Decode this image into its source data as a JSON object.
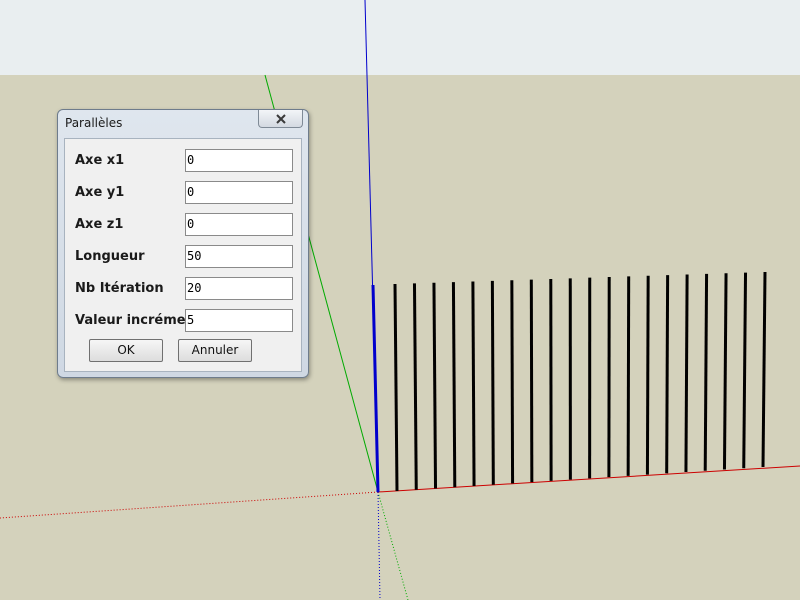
{
  "dialog": {
    "title": "Parallèles",
    "close_icon": "close-icon",
    "fields": [
      {
        "label": "Axe x1",
        "value": "0"
      },
      {
        "label": "Axe y1",
        "value": "0"
      },
      {
        "label": "Axe z1",
        "value": "0"
      },
      {
        "label": "Longueur",
        "value": "50"
      },
      {
        "label": "Nb Itération",
        "value": "20"
      },
      {
        "label": "Valeur incrément",
        "value": "5"
      }
    ],
    "ok_label": "OK",
    "cancel_label": "Annuler"
  },
  "scene": {
    "sky_color": "#e9eef0",
    "ground_color": "#d4d2bc",
    "axis_colors": {
      "x": "#cc0000",
      "y": "#00aa00",
      "z": "#0000cc"
    },
    "line_color": "#000000",
    "parallel_line_count": 20
  }
}
